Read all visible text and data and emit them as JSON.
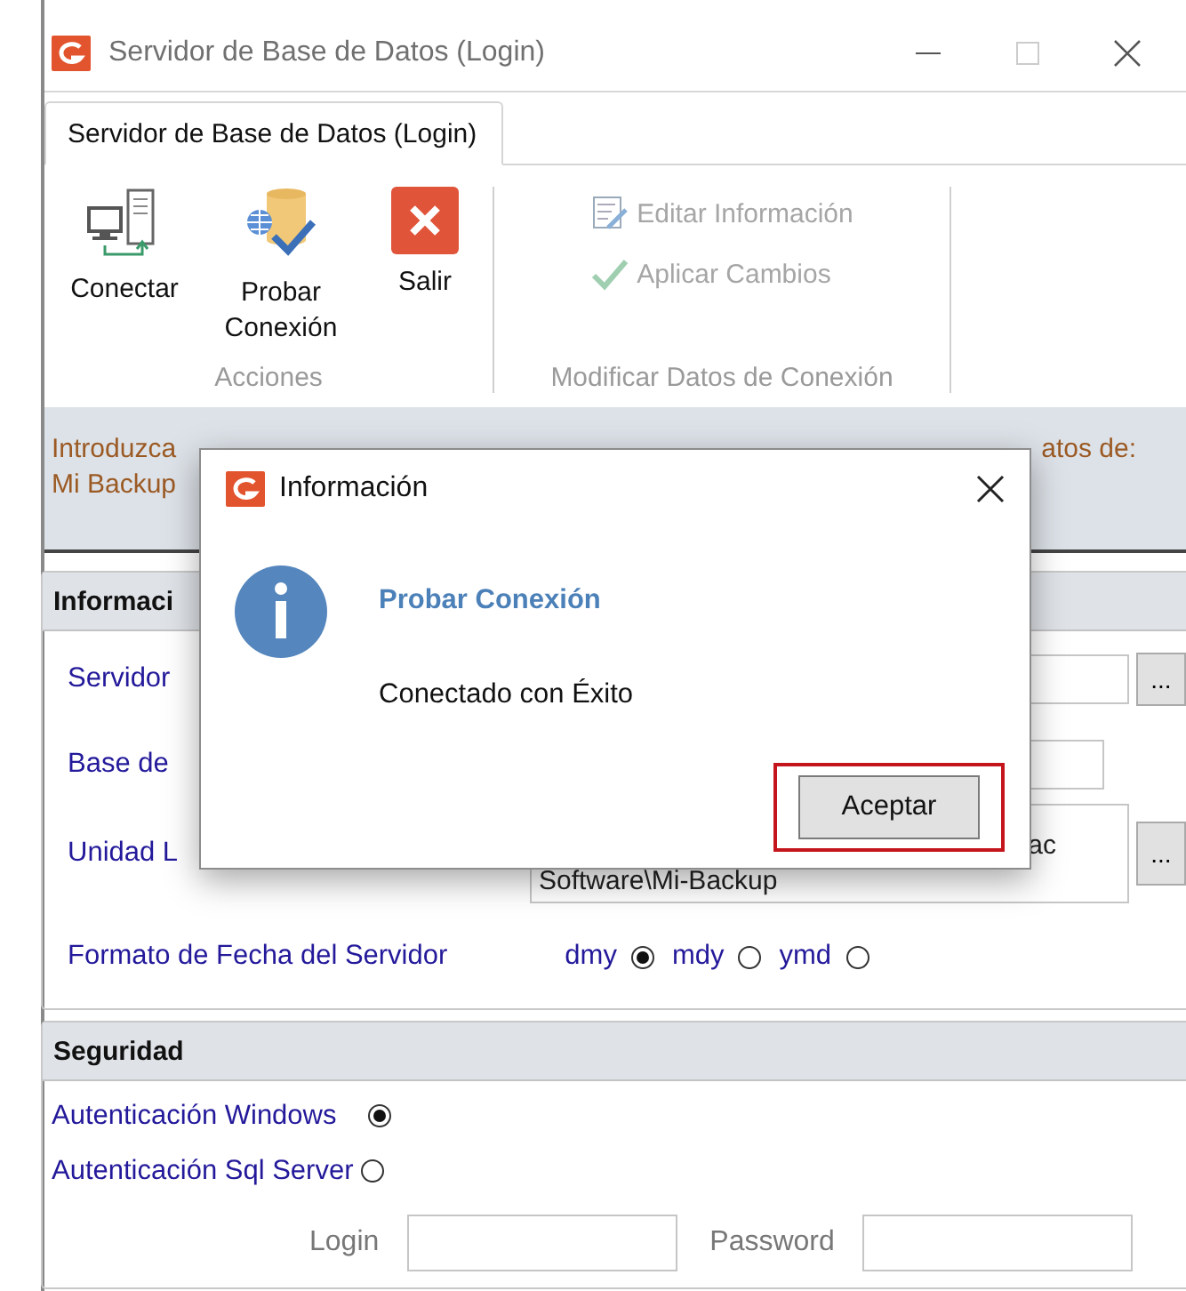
{
  "window": {
    "title": "Servidor de Base de Datos (Login)"
  },
  "tabs": [
    {
      "label": "Servidor de Base de Datos (Login)",
      "selected": true
    }
  ],
  "ribbon": {
    "groups": [
      {
        "label": "Acciones",
        "kind": "large",
        "buttons": [
          {
            "label": "Conectar",
            "disabled": false
          },
          {
            "label": "Probar Conexión",
            "disabled": false
          },
          {
            "label": "Salir",
            "disabled": false
          }
        ]
      },
      {
        "label": "Modificar Datos de Conexión",
        "kind": "small",
        "buttons": [
          {
            "label": "Editar Información",
            "disabled": true
          },
          {
            "label": "Aplicar Cambios",
            "disabled": true
          }
        ]
      }
    ]
  },
  "notice": {
    "left_lines": [
      "Introduzca",
      "Mi Backup"
    ],
    "right_text": "atos de:"
  },
  "connection": {
    "title": "Informaci",
    "fields": [
      {
        "kind": "text",
        "label": "Servidor",
        "browse": "..."
      },
      {
        "kind": "text",
        "label": "Base de"
      },
      {
        "kind": "multiline",
        "label": "Unidad L",
        "lines": [
          "ac",
          "Software\\Mi-Backup"
        ],
        "browse": "..."
      },
      {
        "kind": "radios",
        "label": "Formato de Fecha del Servidor",
        "options": [
          {
            "label": "dmy",
            "selected": true
          },
          {
            "label": "mdy",
            "selected": false
          },
          {
            "label": "ymd",
            "selected": false
          }
        ]
      }
    ]
  },
  "security": {
    "title": "Seguridad",
    "auth": [
      {
        "label": "Autenticación Windows",
        "selected": true
      },
      {
        "label": "Autenticación Sql Server",
        "selected": false
      }
    ],
    "credentials": [
      {
        "label": "Login"
      },
      {
        "label": "Password"
      }
    ]
  },
  "dialog": {
    "title": "Información",
    "heading": "Probar Conexión",
    "message": "Conectado con Éxito",
    "button": {
      "label": "Aceptar",
      "focused": true
    }
  }
}
